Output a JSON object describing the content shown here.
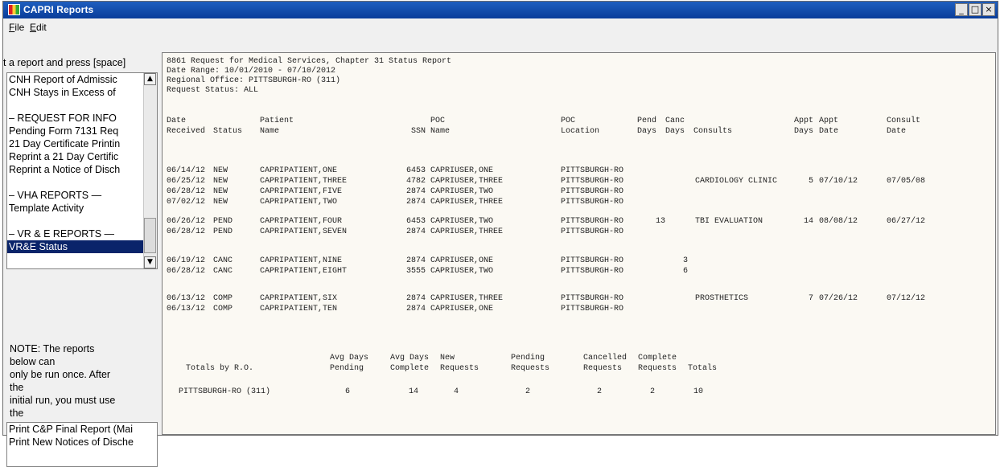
{
  "window": {
    "title": "CAPRI Reports",
    "buttons": [
      "_",
      "□",
      "×"
    ]
  },
  "menu": {
    "file": "File",
    "edit": "Edit"
  },
  "left": {
    "prompt": "t a report and press [space]",
    "list1": [
      {
        "label": "CNH Report of Admissic",
        "selected": false
      },
      {
        "label": "CNH Stays in Excess of",
        "selected": false
      },
      {
        "label": "",
        "selected": false
      },
      {
        "label": "– REQUEST FOR INFO",
        "selected": false
      },
      {
        "label": "Pending Form 7131 Req",
        "selected": false
      },
      {
        "label": "21 Day Certificate Printin",
        "selected": false
      },
      {
        "label": "Reprint a 21 Day Certific",
        "selected": false
      },
      {
        "label": "Reprint a Notice of Disch",
        "selected": false
      },
      {
        "label": "",
        "selected": false
      },
      {
        "label": "– VHA REPORTS —",
        "selected": false
      },
      {
        "label": "Template Activity",
        "selected": false
      },
      {
        "label": "",
        "selected": false
      },
      {
        "label": "– VR & E REPORTS —",
        "selected": false
      },
      {
        "label": "VR&E Status",
        "selected": true
      }
    ],
    "note": [
      "NOTE:  The reports",
      "below can",
      "only be run once.  After",
      "the",
      "initial run, you must use",
      "the"
    ],
    "list2": [
      {
        "label": "Print C&P Final Report (Mai",
        "selected": false
      },
      {
        "label": "Print New Notices of Dische",
        "selected": false
      }
    ]
  },
  "report": {
    "title": "8861 Request for Medical Services, Chapter 31 Status Report",
    "date_range": "Date Range: 10/01/2010 - 07/10/2012",
    "regional_office": "Regional Office: PITTSBURGH-RO (311)",
    "request_status": "Request Status: ALL",
    "headers": {
      "date_received": [
        "Date",
        "Received"
      ],
      "status": [
        "",
        "Status"
      ],
      "patient_name": [
        "Patient",
        "Name"
      ],
      "ssn": [
        "",
        "SSN"
      ],
      "poc_name": [
        "POC",
        "Name"
      ],
      "poc_location": [
        "POC",
        "Location"
      ],
      "pend_days": [
        "Pend",
        "Days"
      ],
      "canc_days": [
        "Canc",
        "Days"
      ],
      "consults": [
        "",
        "Consults"
      ],
      "appt_days": [
        "Appt",
        "Days"
      ],
      "appt_date": [
        "Appt",
        "Date"
      ],
      "consult_date": [
        "Consult",
        "Date"
      ]
    },
    "groups": [
      [
        {
          "date": "06/14/12",
          "status": "NEW",
          "patient": "CAPRIPATIENT,ONE",
          "ssn": "6453",
          "poc": "CAPRIUSER,ONE",
          "location": "PITTSBURGH-RO",
          "pend": "",
          "canc": "",
          "consults": "",
          "appt_days": "",
          "appt_date": "",
          "consult_date": ""
        },
        {
          "date": "06/25/12",
          "status": "NEW",
          "patient": "CAPRIPATIENT,THREE",
          "ssn": "4782",
          "poc": "CAPRIUSER,THREE",
          "location": "PITTSBURGH-RO",
          "pend": "",
          "canc": "",
          "consults": "CARDIOLOGY CLINIC",
          "appt_days": "5",
          "appt_date": "07/10/12",
          "consult_date": "07/05/08"
        },
        {
          "date": "06/28/12",
          "status": "NEW",
          "patient": "CAPRIPATIENT,FIVE",
          "ssn": "2874",
          "poc": "CAPRIUSER,TWO",
          "location": "PITTSBURGH-RO",
          "pend": "",
          "canc": "",
          "consults": "",
          "appt_days": "",
          "appt_date": "",
          "consult_date": ""
        },
        {
          "date": "07/02/12",
          "status": "NEW",
          "patient": "CAPRIPATIENT,TWO",
          "ssn": "2874",
          "poc": "CAPRIUSER,THREE",
          "location": "PITTSBURGH-RO",
          "pend": "",
          "canc": "",
          "consults": "",
          "appt_days": "",
          "appt_date": "",
          "consult_date": ""
        }
      ],
      [
        {
          "date": "06/26/12",
          "status": "PEND",
          "patient": "CAPRIPATIENT,FOUR",
          "ssn": "6453",
          "poc": "CAPRIUSER,TWO",
          "location": "PITTSBURGH-RO",
          "pend": "13",
          "canc": "",
          "consults": "TBI EVALUATION",
          "appt_days": "14",
          "appt_date": "08/08/12",
          "consult_date": "06/27/12"
        },
        {
          "date": "06/28/12",
          "status": "PEND",
          "patient": "CAPRIPATIENT,SEVEN",
          "ssn": "2874",
          "poc": "CAPRIUSER,THREE",
          "location": "PITTSBURGH-RO",
          "pend": "",
          "canc": "",
          "consults": "",
          "appt_days": "",
          "appt_date": "",
          "consult_date": ""
        }
      ],
      [
        {
          "date": "06/19/12",
          "status": "CANC",
          "patient": "CAPRIPATIENT,NINE",
          "ssn": "2874",
          "poc": "CAPRIUSER,ONE",
          "location": "PITTSBURGH-RO",
          "pend": "",
          "canc": "3",
          "consults": "",
          "appt_days": "",
          "appt_date": "",
          "consult_date": ""
        },
        {
          "date": "06/28/12",
          "status": "CANC",
          "patient": "CAPRIPATIENT,EIGHT",
          "ssn": "3555",
          "poc": "CAPRIUSER,TWO",
          "location": "PITTSBURGH-RO",
          "pend": "",
          "canc": "6",
          "consults": "",
          "appt_days": "",
          "appt_date": "",
          "consult_date": ""
        }
      ],
      [
        {
          "date": "06/13/12",
          "status": "COMP",
          "patient": "CAPRIPATIENT,SIX",
          "ssn": "2874",
          "poc": "CAPRIUSER,THREE",
          "location": "PITTSBURGH-RO",
          "pend": "",
          "canc": "",
          "consults": "PROSTHETICS",
          "appt_days": "7",
          "appt_date": "07/26/12",
          "consult_date": "07/12/12"
        },
        {
          "date": "06/13/12",
          "status": "COMP",
          "patient": "CAPRIPATIENT,TEN",
          "ssn": "2874",
          "poc": "CAPRIUSER,ONE",
          "location": "PITTSBURGH-RO",
          "pend": "",
          "canc": "",
          "consults": "",
          "appt_days": "",
          "appt_date": "",
          "consult_date": ""
        }
      ]
    ],
    "totals": {
      "label": "Totals by R.O.",
      "headers": {
        "avg_pending": [
          "Avg Days",
          "Pending"
        ],
        "avg_complete": [
          "Avg Days",
          "Complete"
        ],
        "new": [
          "New",
          "Requests"
        ],
        "pending": [
          "Pending",
          "Requests"
        ],
        "cancelled": [
          "Cancelled",
          "Requests"
        ],
        "complete": [
          "Complete",
          "Requests"
        ],
        "totals": [
          "",
          "Totals"
        ]
      },
      "row": {
        "ro": "PITTSBURGH-RO (311)",
        "avg_pending": "6",
        "avg_complete": "14",
        "new": "4",
        "pending": "2",
        "cancelled": "2",
        "complete": "2",
        "totals": "10"
      }
    }
  }
}
